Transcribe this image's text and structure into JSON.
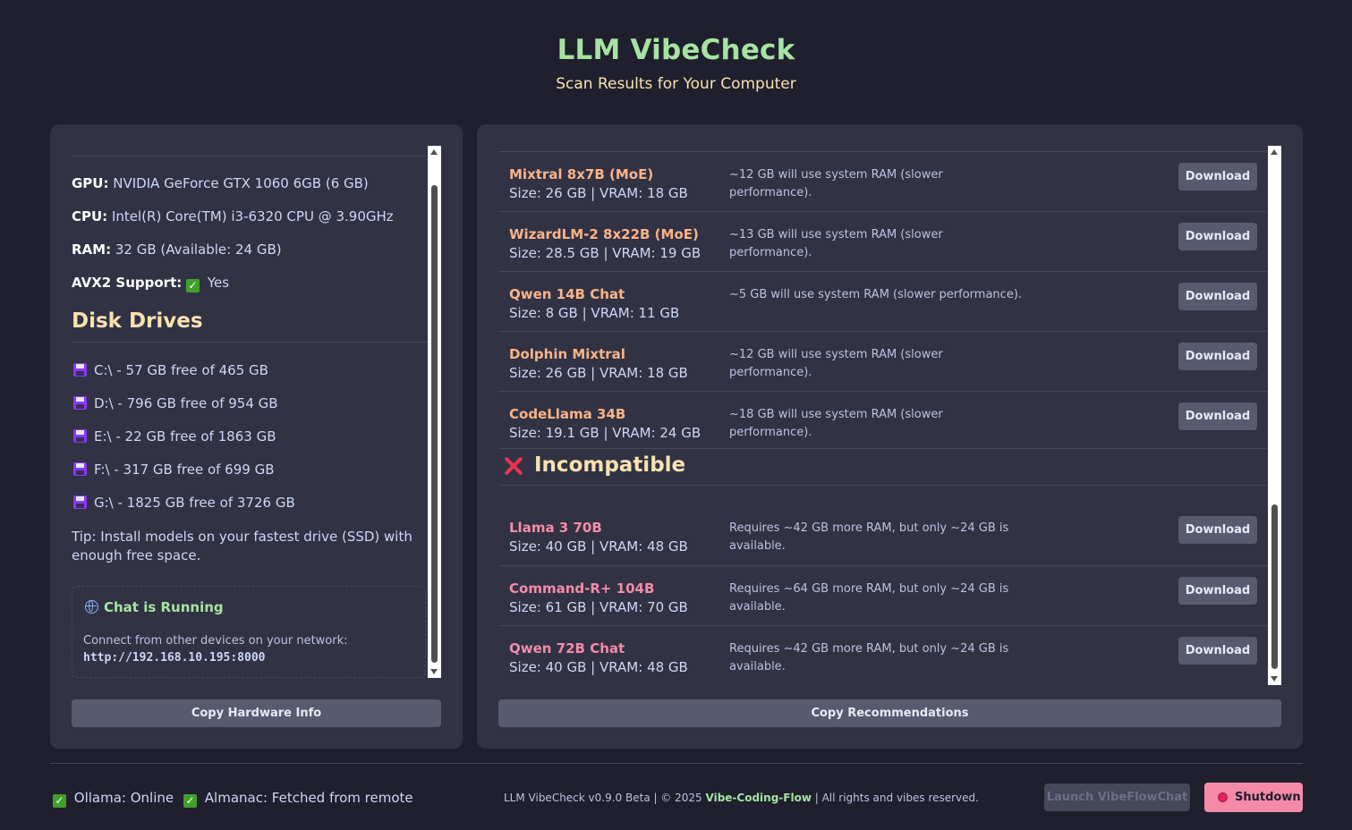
{
  "header": {
    "title": "LLM VibeCheck",
    "subtitle": "Scan Results for Your Computer"
  },
  "hardware": {
    "gpu_label": "GPU:",
    "gpu_value": "NVIDIA GeForce GTX 1060 6GB (6 GB)",
    "cpu_label": "CPU:",
    "cpu_value": "Intel(R) Core(TM) i3-6320 CPU @ 3.90GHz",
    "ram_label": "RAM:",
    "ram_value": "32 GB (Available: 24 GB)",
    "avx2_label": "AVX2 Support:",
    "avx2_check": "✓",
    "avx2_value": "Yes"
  },
  "disks": {
    "title": "Disk Drives",
    "drives": [
      "C:\\ - 57 GB free of 465 GB",
      "D:\\ - 796 GB free of 954 GB",
      "E:\\ - 22 GB free of 1863 GB",
      "F:\\ - 317 GB free of 699 GB",
      "G:\\ - 1825 GB free of 3726 GB"
    ],
    "icon": "floppy-disk-icon",
    "tip": "Tip: Install models on your fastest drive (SSD) with enough free space."
  },
  "chat": {
    "icon": "globe-icon",
    "title": "Chat is Running",
    "description": "Connect from other devices on your network:",
    "url": "http://192.168.10.195:8000"
  },
  "buttons": {
    "copy_hardware": "Copy Hardware Info",
    "copy_recommendations": "Copy Recommendations",
    "download": "Download",
    "launch": "Launch VibeFlowChat",
    "shutdown": "Shutdown"
  },
  "models_compatible": [
    {
      "name": "Mixtral 8x7B (MoE)",
      "size": "Size: 26 GB | VRAM: 18 GB",
      "note": "~12 GB will use system RAM (slower performance)."
    },
    {
      "name": "WizardLM-2 8x22B (MoE)",
      "size": "Size: 28.5 GB | VRAM: 19 GB",
      "note": "~13 GB will use system RAM (slower performance)."
    },
    {
      "name": "Qwen 14B Chat",
      "size": "Size: 8 GB | VRAM: 11 GB",
      "note": "~5 GB will use system RAM (slower performance)."
    },
    {
      "name": "Dolphin Mixtral",
      "size": "Size: 26 GB | VRAM: 18 GB",
      "note": "~12 GB will use system RAM (slower performance)."
    },
    {
      "name": "CodeLlama 34B",
      "size": "Size: 19.1 GB | VRAM: 24 GB",
      "note": "~18 GB will use system RAM (slower performance)."
    }
  ],
  "incompatible": {
    "title": "Incompatible",
    "icon": "x-mark-icon",
    "models": [
      {
        "name": "Llama 3 70B",
        "size": "Size: 40 GB | VRAM: 48 GB",
        "note": "Requires ~42 GB more RAM, but only ~24 GB is available."
      },
      {
        "name": "Command-R+ 104B",
        "size": "Size: 61 GB | VRAM: 70 GB",
        "note": "Requires ~64 GB more RAM, but only ~24 GB is available."
      },
      {
        "name": "Qwen 72B Chat",
        "size": "Size: 40 GB | VRAM: 48 GB",
        "note": "Requires ~42 GB more RAM, but only ~24 GB is available."
      }
    ]
  },
  "footer": {
    "ollama_status": "Ollama: Online",
    "almanac_status": "Almanac: Fetched from remote",
    "status_check": "✓",
    "version_prefix": "LLM VibeCheck v0.9.0 Beta | © 2025 ",
    "brand": "Vibe-Coding-Flow",
    "version_suffix": " | All rights and vibes reserved."
  },
  "colors": {
    "background": "#1f1f2e",
    "panel": "#313244",
    "title_green": "#a6e3a1",
    "accent_yellow": "#f9e2af",
    "compatible_orange": "#fab387",
    "incompatible_pink": "#f38ba8",
    "shutdown_pink": "#f38ba8"
  }
}
